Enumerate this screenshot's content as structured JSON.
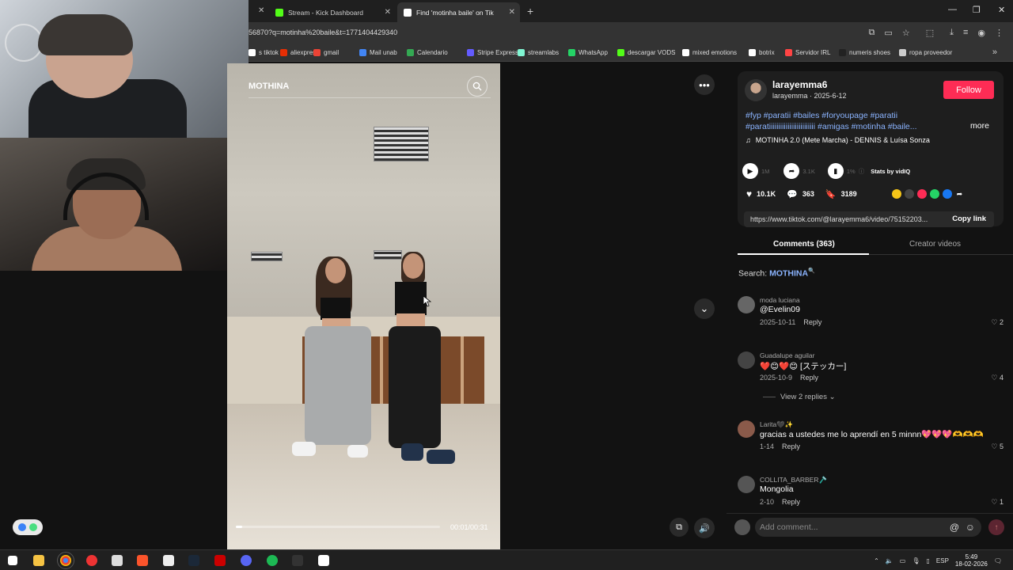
{
  "browser": {
    "tabs": [
      {
        "label": "Stream - Kick Dashboard",
        "color": "#53fc18"
      },
      {
        "label": "Find 'motinha baile' on Tik",
        "color": "#ffffff"
      }
    ],
    "new_tab": "+",
    "url": "56870?q=motinha%20baile&t=1771404429340",
    "bookmarks": [
      {
        "label": "s tiktok",
        "color": "#ffffff"
      },
      {
        "label": "aliexpres",
        "color": "#e62e04"
      },
      {
        "label": "gmail",
        "color": "#ea4335"
      },
      {
        "label": "Mail unab",
        "color": "#4285f4"
      },
      {
        "label": "Calendario",
        "color": "#34a853"
      },
      {
        "label": "Stripe Express",
        "color": "#635bff"
      },
      {
        "label": "streamlabs",
        "color": "#80f5d2"
      },
      {
        "label": "WhatsApp",
        "color": "#25d366"
      },
      {
        "label": "descargar VODS",
        "color": "#53fc18"
      },
      {
        "label": "mixed emotions",
        "color": "#ffffff"
      },
      {
        "label": "botrix",
        "color": "#ffffff"
      },
      {
        "label": "Servidor IRL",
        "color": "#ff4444"
      },
      {
        "label": "numeris shoes",
        "color": "#222222"
      },
      {
        "label": "ropa proveedor",
        "color": "#cccccc"
      }
    ]
  },
  "video": {
    "search_text": "MOTHINA",
    "time": "00:01/00:31",
    "progress_fraction": 0.03
  },
  "profile": {
    "username": "larayemma6",
    "subline": "larayemma · 2025-6-12",
    "follow_label": "Follow",
    "description": "#fyp #paratii #bailes #foryoupage #paratii #paratiiiiiiiiiiiiiiiiiiiiiiiii #amigas #motinha #baile...",
    "more_label": "more",
    "music": "MOTINHA 2.0 (Mete Marcha) - DENNIS & Luísa Sonza",
    "stats": {
      "plays": "1M",
      "shares": "3.1K",
      "pct": "1%",
      "vidiq": "Stats by vidIQ"
    },
    "likes": "10.1K",
    "comments": "363",
    "saves": "3189",
    "link": "https://www.tiktok.com/@larayemma6/video/75152203...",
    "copy_label": "Copy link"
  },
  "tabs": {
    "comments": "Comments (363)",
    "creator": "Creator videos"
  },
  "search_ref": {
    "label": "Search:",
    "term": "MOTHINA"
  },
  "comments": [
    {
      "name": "moda luciana",
      "text": "@Evelin09",
      "date": "2025-10-11",
      "reply": "Reply",
      "likes": "2",
      "color": "#666666"
    },
    {
      "name": "Guadalupe aguilar",
      "text": "❤️😊❤️😊 [ステッカー]",
      "date": "2025-10-9",
      "reply": "Reply",
      "likes": "4",
      "color": "#444444"
    },
    {
      "name": "Larita🖤✨",
      "text": "gracias a ustedes me lo aprendí en 5 minnn💖💖💖🫶🫶🫶",
      "date": "1-14",
      "reply": "Reply",
      "likes": "5",
      "color": "#8a5a4a"
    },
    {
      "name": "COLLITA_BARBER🪒",
      "text": "Mongolia",
      "date": "2-10",
      "reply": "Reply",
      "likes": "1",
      "color": "#555555"
    }
  ],
  "view_replies": "View 2 replies ⌄",
  "add_comment_placeholder": "Add comment...",
  "taskbar": {
    "lang": "ESP",
    "time": "5:49",
    "date": "18-02-2026"
  }
}
